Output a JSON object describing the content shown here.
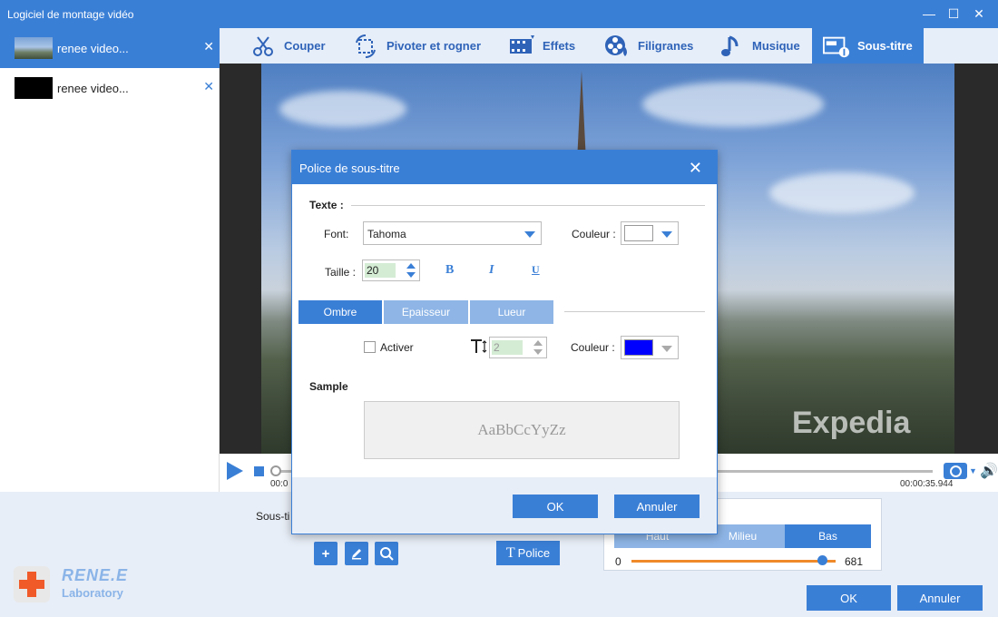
{
  "window": {
    "title": "Logiciel de montage vidéo",
    "minimize": "—",
    "maximize": "☐",
    "close": "✕"
  },
  "files": [
    {
      "name": "renee video...",
      "close": "✕",
      "active": true
    },
    {
      "name": "renee video...",
      "close": "✕",
      "active": false
    }
  ],
  "toolbar": [
    {
      "label": "Couper",
      "icon": "scissors-icon"
    },
    {
      "label": "Pivoter et rogner",
      "icon": "rotate-crop-icon"
    },
    {
      "label": "Effets",
      "icon": "film-effects-icon"
    },
    {
      "label": "Filigranes",
      "icon": "watermark-reel-icon"
    },
    {
      "label": "Musique",
      "icon": "music-note-icon"
    },
    {
      "label": "Sous-titre",
      "icon": "subtitle-icon",
      "active": true
    }
  ],
  "video": {
    "watermark": "Expedia"
  },
  "player": {
    "time_current": "00:0",
    "time_total": "00:00:35.944"
  },
  "bottom": {
    "subtitle_label": "Sous-ti",
    "police_button": "Police",
    "position_buttons": [
      "Haut",
      "Milieu",
      "Bas"
    ],
    "position_selected": "Bas",
    "slider_min": "0",
    "slider_max": "681",
    "slider_fraction": 0.93,
    "ok": "OK",
    "cancel": "Annuler"
  },
  "logo": {
    "line1": "RENE.E",
    "line2": "Laboratory"
  },
  "dialog": {
    "title": "Police de sous-titre",
    "close": "✕",
    "texte_section": "Texte :",
    "font_label": "Font:",
    "font_value": "Tahoma",
    "couleur_label": "Couleur :",
    "text_color": "#ffffff",
    "taille_label": "Taille :",
    "taille_value": "20",
    "bold": "B",
    "italic": "I",
    "underline": "U",
    "tabs": [
      "Ombre",
      "Epaisseur",
      "Lueur"
    ],
    "active_tab": "Ombre",
    "activer_label": "Activer",
    "activer_checked": false,
    "shadow_size": "2",
    "shadow_couleur_label": "Couleur :",
    "shadow_color": "#0000ff",
    "sample_section": "Sample",
    "sample_text": "AaBbCcYyZz",
    "ok": "OK",
    "cancel": "Annuler"
  },
  "colors": {
    "accent": "#3a7fd6",
    "accent_light": "#8eb5e6",
    "panel_bg": "#e8eef7",
    "slider": "#f08a2a"
  }
}
